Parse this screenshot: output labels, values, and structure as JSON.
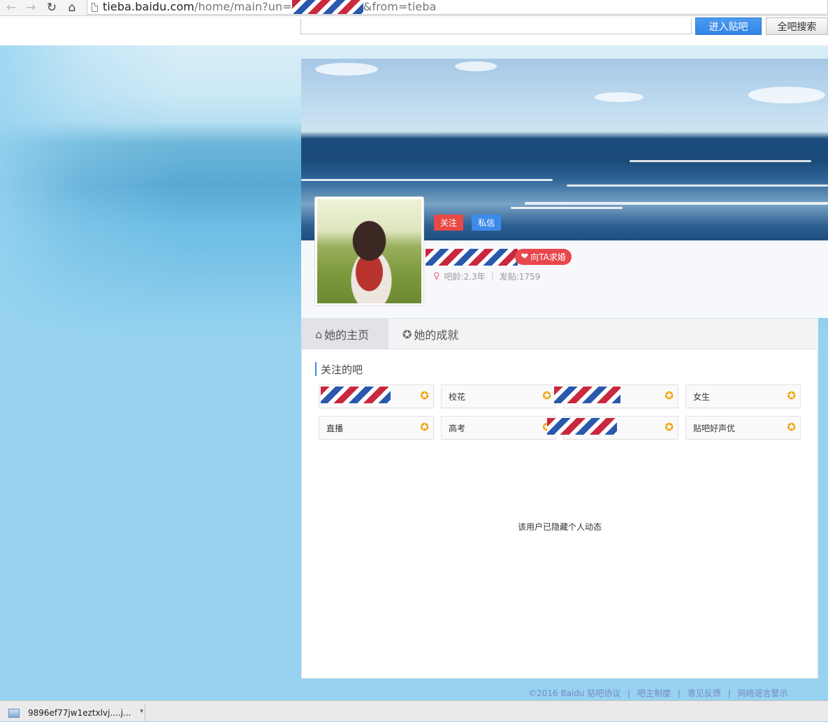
{
  "browser": {
    "url_host": "tieba.baidu.com",
    "url_path": "/home/main?un=",
    "url_query": "&from=tieba",
    "back_icon": "back-arrow-icon",
    "forward_icon": "forward-arrow-icon",
    "reload_icon": "reload-icon",
    "home_icon": "home-icon"
  },
  "search": {
    "enter_forum_label": "进入贴吧",
    "all_forum_search_label": "全吧搜索"
  },
  "profile": {
    "follow_label": "关注",
    "message_label": "私信",
    "propose_label": "向TA求婚",
    "forum_age": "吧龄:2.3年",
    "post_count": "发贴:1759"
  },
  "tabs": [
    {
      "label": "她的主页",
      "icon": "home-icon",
      "active": true
    },
    {
      "label": "她的成就",
      "icon": "medal-icon",
      "active": false
    }
  ],
  "followed_forums": {
    "title": "关注的吧",
    "items": [
      "",
      "校花",
      "",
      "女生",
      "直播",
      "高考",
      "",
      "贴吧好声优"
    ]
  },
  "hidden_activity_note": "该用户已隐藏个人动态",
  "footer": {
    "copyright": "©2016 Baidu",
    "links": [
      "贴吧协议",
      "吧主制度",
      "意见反馈",
      "网络谣言警示"
    ]
  },
  "download": {
    "file_name": "9896ef77jw1eztxlvj....j..."
  },
  "colors": {
    "accent_blue": "#3d8be8",
    "follow_red": "#e84945",
    "star_orange": "#f0a000",
    "page_bg": "#97d3f0"
  }
}
